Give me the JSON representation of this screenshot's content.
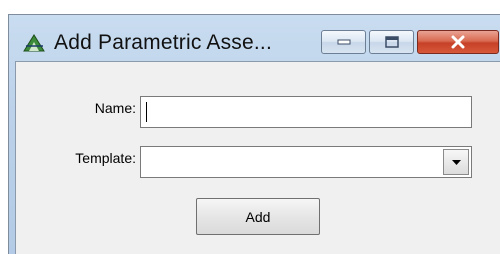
{
  "window": {
    "title": "Add Parametric Asse...",
    "app_icon": "green-triangle-app-icon",
    "controls": {
      "minimize_icon": "minimize-icon",
      "maximize_icon": "maximize-icon",
      "close_icon": "close-icon",
      "close_color": "#c64127"
    }
  },
  "form": {
    "name_label": "Name:",
    "name_value": "",
    "template_label": "Template:",
    "template_value": "",
    "add_button": "Add"
  }
}
